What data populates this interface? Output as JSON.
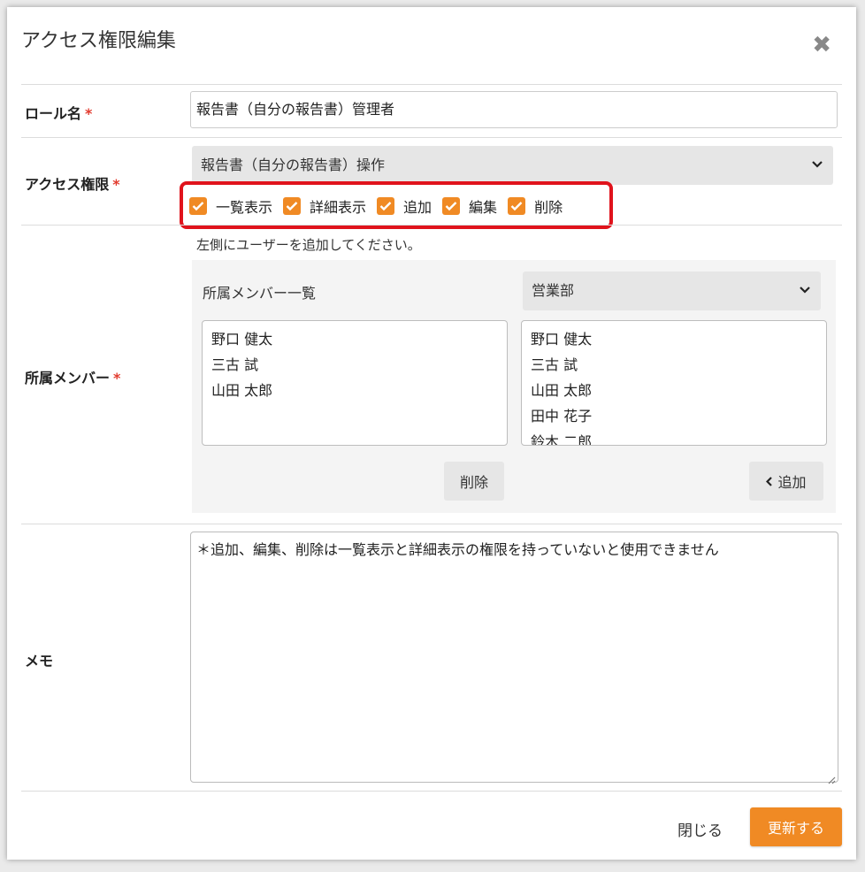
{
  "dialog": {
    "title": "アクセス権限編集",
    "close_icon": "close-icon"
  },
  "role": {
    "label": "ロール名",
    "required_mark": "*",
    "value": "報告書（自分の報告書）管理者"
  },
  "access": {
    "label": "アクセス権限",
    "required_mark": "*",
    "selected": "報告書（自分の報告書）操作",
    "permissions": [
      {
        "label": "一覧表示",
        "checked": true
      },
      {
        "label": "詳細表示",
        "checked": true
      },
      {
        "label": "追加",
        "checked": true
      },
      {
        "label": "編集",
        "checked": true
      },
      {
        "label": "削除",
        "checked": true
      }
    ]
  },
  "members": {
    "label": "所属メンバー",
    "required_mark": "*",
    "hint": "左側にユーザーを追加してください。",
    "list_title": "所属メンバー一覧",
    "department_selected": "営業部",
    "assigned": [
      "野口 健太",
      "三古 試",
      "山田 太郎"
    ],
    "available": [
      "野口 健太",
      "三古 試",
      "山田 太郎",
      "田中 花子",
      "鈴木 二郎"
    ],
    "remove_label": "削除",
    "add_label": "追加"
  },
  "memo": {
    "label": "メモ",
    "value": "＊追加、編集、削除は一覧表示と詳細表示の権限を持っていないと使用できません"
  },
  "footer": {
    "close_label": "閉じる",
    "update_label": "更新する"
  },
  "colors": {
    "accent": "#f08a24",
    "highlight_border": "#e0131c",
    "required": "#e23b2e"
  }
}
